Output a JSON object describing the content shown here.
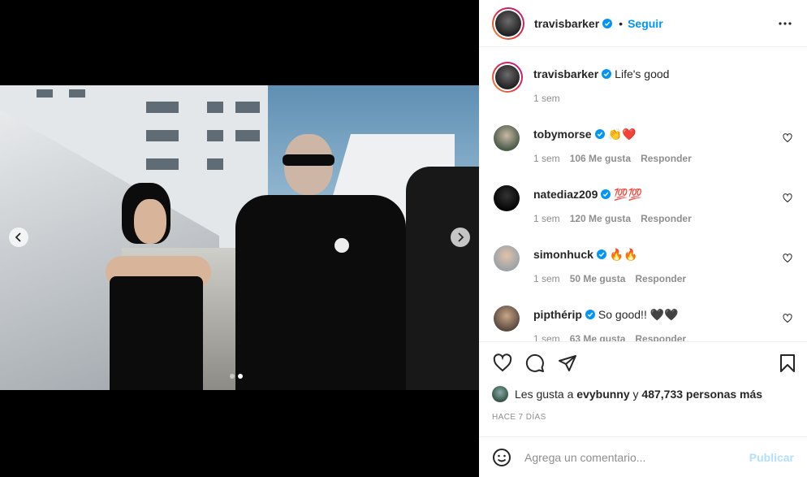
{
  "post": {
    "author": "travisbarker",
    "follow_label": "Seguir",
    "separator": "•",
    "caption": "Life's good",
    "caption_time": "1 sem"
  },
  "media": {
    "carousel_count": 2,
    "carousel_active": 2
  },
  "comments": [
    {
      "user": "tobymorse",
      "verified": true,
      "text": "👏❤️",
      "time": "1 sem",
      "likes": "106 Me gusta",
      "reply": "Responder"
    },
    {
      "user": "natediaz209",
      "verified": true,
      "text": "💯💯",
      "time": "1 sem",
      "likes": "120 Me gusta",
      "reply": "Responder"
    },
    {
      "user": "simonhuck",
      "verified": true,
      "text": "🔥🔥",
      "time": "1 sem",
      "likes": "50 Me gusta",
      "reply": "Responder"
    },
    {
      "user": "pipthérip",
      "verified": true,
      "text": "So good!! 🖤🖤",
      "time": "1 sem",
      "likes": "63 Me gusta",
      "reply": "Responder"
    }
  ],
  "likes": {
    "prefix": "Les gusta a",
    "user": "evybunny",
    "joiner": "y",
    "others": "487,733 personas más"
  },
  "timestamp": "Hace 7 días",
  "comment_box": {
    "placeholder": "Agrega un comentario...",
    "publish_label": "Publicar"
  },
  "colors": {
    "accent": "#0095f6",
    "publish_disabled": "#b2dffc",
    "muted": "#8e8e8e",
    "text": "#262626"
  },
  "icons": [
    "more-icon",
    "verified-icon",
    "heart-icon",
    "comment-icon",
    "share-icon",
    "bookmark-icon",
    "emoji-icon",
    "chevron-left-icon",
    "chevron-right-icon"
  ]
}
